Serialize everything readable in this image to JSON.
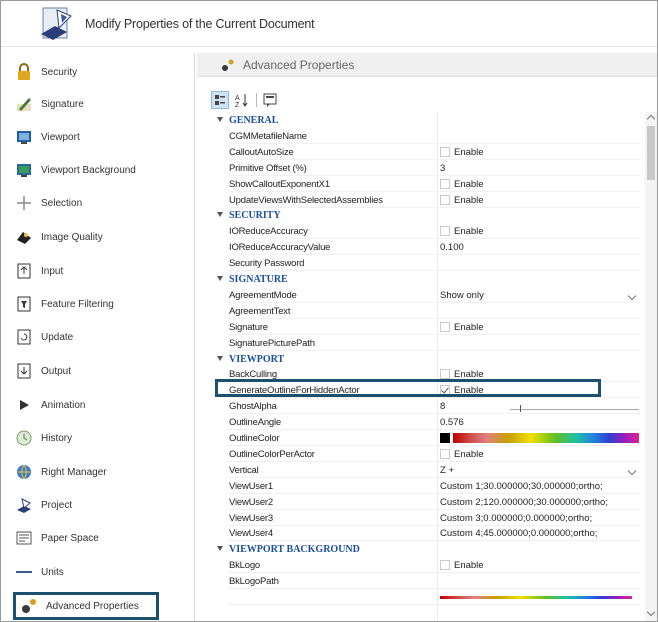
{
  "window": {
    "title": "Modify Properties of the Current Document",
    "title_icon": "document-properties-icon"
  },
  "sidebar": {
    "items": [
      {
        "label": "Security",
        "icon": "padlock-icon",
        "selected": false
      },
      {
        "label": "Signature",
        "icon": "signature-pen-icon",
        "selected": false
      },
      {
        "label": "Viewport",
        "icon": "viewport-icon",
        "selected": false
      },
      {
        "label": "Viewport Background",
        "icon": "viewport-background-icon",
        "selected": false
      },
      {
        "label": "Selection",
        "icon": "crosshair-icon",
        "selected": false
      },
      {
        "label": "Image Quality",
        "icon": "image-quality-icon",
        "selected": false
      },
      {
        "label": "Input",
        "icon": "input-icon",
        "selected": false
      },
      {
        "label": "Feature Filtering",
        "icon": "filter-icon",
        "selected": false
      },
      {
        "label": "Update",
        "icon": "update-icon",
        "selected": false
      },
      {
        "label": "Output",
        "icon": "output-icon",
        "selected": false
      },
      {
        "label": "Animation",
        "icon": "play-icon",
        "selected": false
      },
      {
        "label": "History",
        "icon": "history-icon",
        "selected": false
      },
      {
        "label": "Right Manager",
        "icon": "rights-manager-icon",
        "selected": false
      },
      {
        "label": "Project",
        "icon": "project-icon",
        "selected": false
      },
      {
        "label": "Paper Space",
        "icon": "paper-space-icon",
        "selected": false
      },
      {
        "label": "Units",
        "icon": "units-ruler-icon",
        "selected": false
      },
      {
        "label": "Advanced Properties",
        "icon": "gears-icon",
        "selected": true
      }
    ]
  },
  "panel": {
    "title": "Advanced Properties",
    "icon": "gears-icon",
    "toolbar": [
      {
        "name": "categorized-view-button",
        "icon": "categorized-icon"
      },
      {
        "name": "alphabetical-view-button",
        "icon": "sort-az-icon"
      },
      {
        "name": "property-pages-button",
        "icon": "property-pages-icon"
      }
    ]
  },
  "grid": {
    "rows": [
      {
        "type": "category",
        "label": "GENERAL"
      },
      {
        "type": "prop",
        "name": "CGMMetafileName",
        "value": ""
      },
      {
        "type": "check",
        "name": "CalloutAutoSize",
        "checked": false,
        "value": "Enable"
      },
      {
        "type": "prop",
        "name": "Primitive Offset (%)",
        "value": "3"
      },
      {
        "type": "check",
        "name": "ShowCalloutExponentX1",
        "checked": false,
        "value": "Enable"
      },
      {
        "type": "check",
        "name": "UpdateViewsWithSelectedAssemblies",
        "checked": false,
        "value": "Enable"
      },
      {
        "type": "category",
        "label": "SECURITY"
      },
      {
        "type": "check",
        "name": "IOReduceAccuracy",
        "checked": false,
        "value": "Enable"
      },
      {
        "type": "prop",
        "name": "IOReduceAccuracyValue",
        "value": "0.100"
      },
      {
        "type": "prop",
        "name": "Security Password",
        "value": ""
      },
      {
        "type": "category",
        "label": "SIGNATURE"
      },
      {
        "type": "dropdown",
        "name": "AgreementMode",
        "value": "Show only"
      },
      {
        "type": "prop",
        "name": "AgreementText",
        "value": ""
      },
      {
        "type": "check",
        "name": "Signature",
        "checked": false,
        "value": "Enable"
      },
      {
        "type": "prop",
        "name": "SignaturePicturePath",
        "value": ""
      },
      {
        "type": "category",
        "label": "VIEWPORT"
      },
      {
        "type": "check",
        "name": "BackCulling",
        "checked": false,
        "value": "Enable"
      },
      {
        "type": "check",
        "name": "GenerateOutlineForHiddenActor",
        "checked": true,
        "value": "Enable"
      },
      {
        "type": "slider",
        "name": "GhostAlpha",
        "value": "8",
        "level": 8
      },
      {
        "type": "prop",
        "name": "OutlineAngle",
        "value": "0.576"
      },
      {
        "type": "color",
        "name": "OutlineColor",
        "value": "#000000"
      },
      {
        "type": "check",
        "name": "OutlineColorPerActor",
        "checked": false,
        "value": "Enable"
      },
      {
        "type": "dropdown",
        "name": "Vertical",
        "value": "Z +"
      },
      {
        "type": "prop",
        "name": "ViewUser1",
        "value": "Custom 1;30.000000;30.000000;ortho;"
      },
      {
        "type": "prop",
        "name": "ViewUser2",
        "value": "Custom 2;120.000000;30.000000;ortho;"
      },
      {
        "type": "prop",
        "name": "ViewUser3",
        "value": "Custom 3;0.000000;0.000000;ortho;"
      },
      {
        "type": "prop",
        "name": "ViewUser4",
        "value": "Custom 4;45.000000;0.000000;ortho;"
      },
      {
        "type": "category",
        "label": "VIEWPORT BACKGROUND"
      },
      {
        "type": "check",
        "name": "BkLogo",
        "checked": false,
        "value": "Enable"
      },
      {
        "type": "prop",
        "name": "BkLogoPath",
        "value": ""
      },
      {
        "type": "partial",
        "name": "",
        "value": ""
      }
    ]
  },
  "colors": {
    "category_text": "#1b4f9c",
    "highlight_border": "#1d4f6e"
  }
}
